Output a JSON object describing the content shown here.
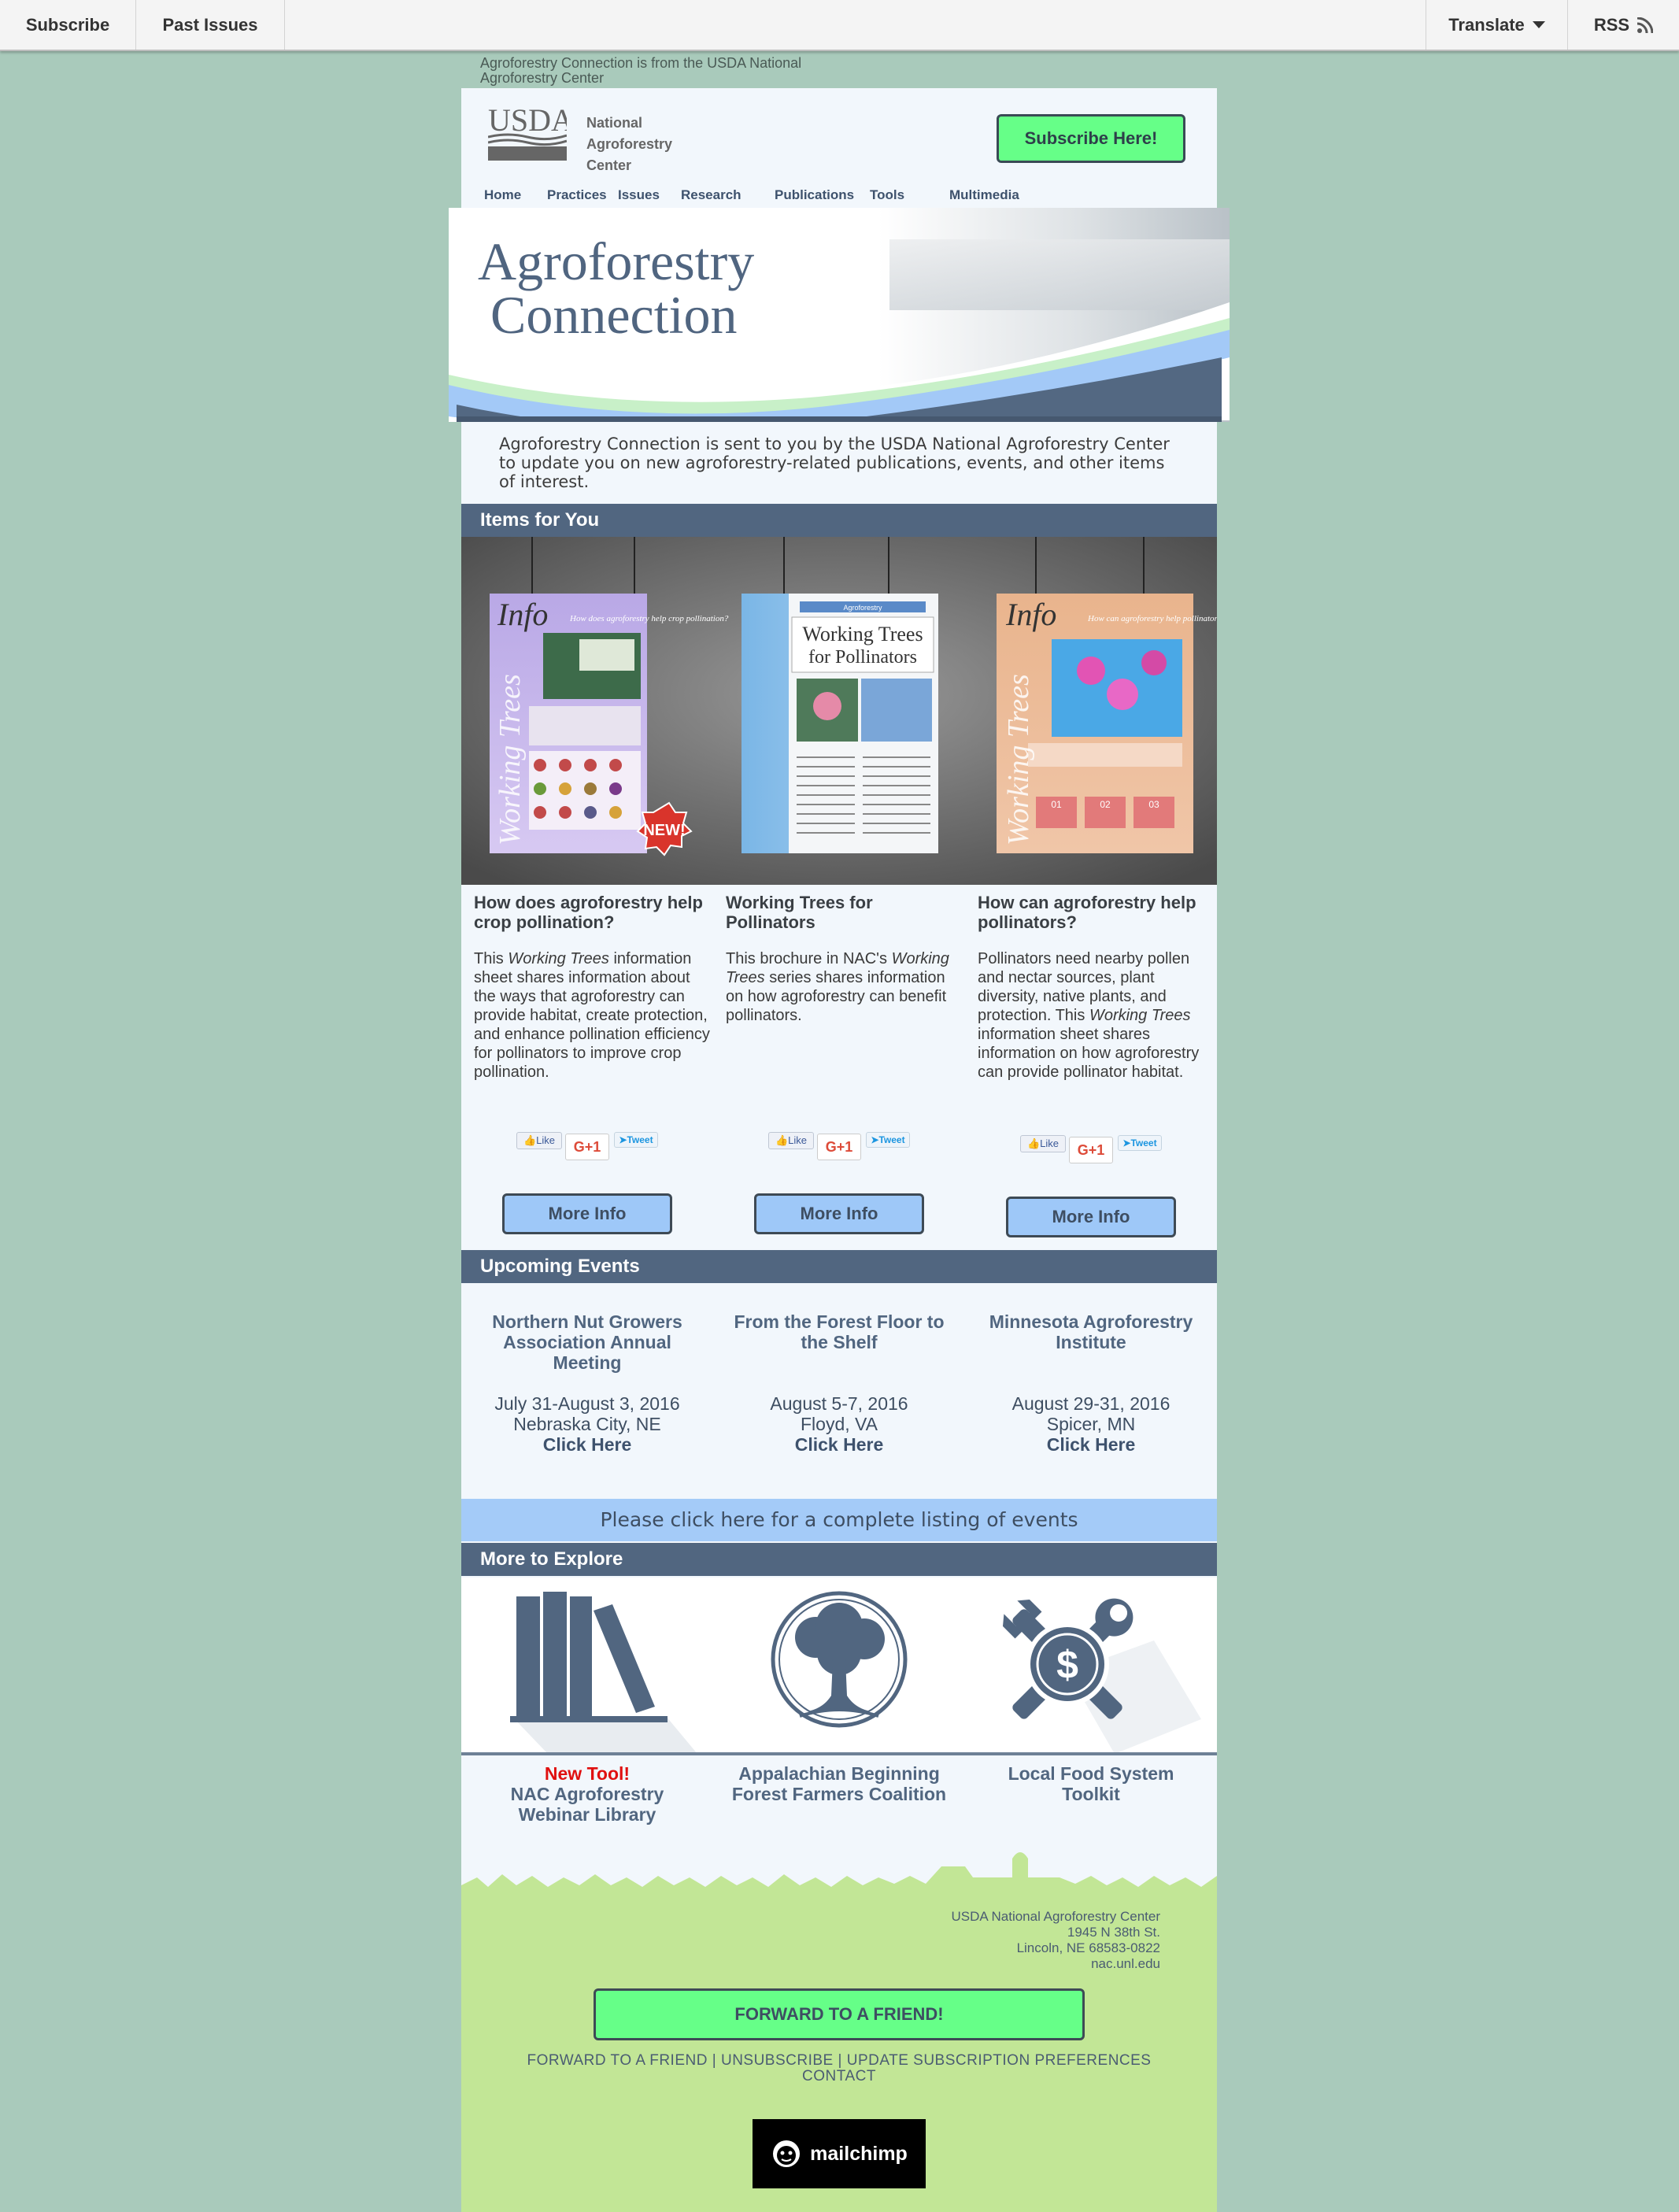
{
  "topbar": {
    "subscribe": "Subscribe",
    "past_issues": "Past Issues",
    "translate": "Translate",
    "rss": "RSS"
  },
  "preheader": "Agroforestry Connection is from the USDA National Agroforestry Center",
  "header": {
    "logo_text": "USDA",
    "center_lines": [
      "National",
      "Agroforestry",
      "Center"
    ],
    "subscribe_button": "Subscribe Here!"
  },
  "nav": [
    "Home",
    "Practices",
    "Issues",
    "Research",
    "Publications",
    "Tools",
    "Multimedia"
  ],
  "banner": {
    "title_line1": "Agroforestry",
    "title_line2": "Connection"
  },
  "intro": "Agroforestry Connection is sent to you by the USDA National Agroforestry Center to update you on new agroforestry-related publications, events, and other items of interest.",
  "items_section": {
    "title": "Items for You",
    "posters": [
      {
        "badge": "Info",
        "side_text": "Working Trees",
        "question": "How does agroforestry help crop pollination?",
        "new_badge": "NEW!"
      },
      {
        "header": "Agroforestry",
        "title_line1": "Working Trees",
        "title_line2": "for Pollinators"
      },
      {
        "badge": "Info",
        "side_text": "Working Trees",
        "question": "How can agroforestry help pollinators?",
        "steps": [
          "01",
          "02",
          "03"
        ]
      }
    ],
    "items": [
      {
        "title": "How does agroforestry help crop pollination?",
        "text_before": "This ",
        "text_italic": "Working Trees",
        "text_after": " information sheet shares information about the ways that agroforestry can provide habitat, create protection, and enhance pollination efficiency for pollinators to improve crop pollination.",
        "button": "More Info"
      },
      {
        "title": "Working Trees for Pollinators",
        "text_before": "This brochure in NAC's ",
        "text_italic": "Working Trees",
        "text_after": " series shares information on how agroforestry can benefit pollinators.",
        "button": "More Info"
      },
      {
        "title": "How can agroforestry help pollinators?",
        "text_before": "Pollinators need nearby pollen and nectar sources, plant diversity, native plants, and protection. This ",
        "text_italic": "Working Trees",
        "text_after": " information sheet shares information on how agroforestry can provide pollinator habitat.",
        "button": "More Info"
      }
    ],
    "social": {
      "like": "Like",
      "gplus": "G+1",
      "tweet": "Tweet"
    }
  },
  "events_section": {
    "title": "Upcoming Events",
    "events": [
      {
        "title": "Northern Nut Growers Association Annual Meeting",
        "date": "July 31-August 3, 2016",
        "place": "Nebraska City, NE",
        "link": "Click Here"
      },
      {
        "title": "From the Forest Floor to the Shelf",
        "date": "August 5-7, 2016",
        "place": "Floyd, VA",
        "link": "Click Here"
      },
      {
        "title": "Minnesota Agroforestry Institute",
        "date": "August 29-31, 2016",
        "place": "Spicer, MN",
        "link": "Click Here"
      }
    ],
    "all_events": "Please click here for a complete listing of events"
  },
  "explore_section": {
    "title": "More to Explore",
    "items": [
      {
        "highlight": "New Tool!",
        "label_line1": "NAC Agroforestry",
        "label_line2": "Webinar Library"
      },
      {
        "label_line1": "Appalachian Beginning",
        "label_line2": "Forest Farmers Coalition"
      },
      {
        "label_line1": "Local Food System",
        "label_line2": "Toolkit"
      }
    ],
    "toolkit_symbol": "$"
  },
  "footer": {
    "address": [
      "USDA National Agroforestry Center",
      "1945 N 38th St.",
      "Lincoln, NE 68583-0822",
      "nac.unl.edu"
    ],
    "forward_button": "FORWARD TO A FRIEND!",
    "links": {
      "forward": "FORWARD TO A FRIEND",
      "unsubscribe": "UNSUBSCRIBE",
      "preferences": "UPDATE SUBSCRIPTION PREFERENCES",
      "contact": "CONTACT",
      "separator": " | "
    },
    "mailchimp": "mailchimp"
  },
  "colors": {
    "page_bg": "#a9cabb",
    "header_bar": "#516680",
    "accent_green": "#66ff88",
    "accent_blue": "#9ec8f8",
    "footer_green": "#c2e696"
  }
}
